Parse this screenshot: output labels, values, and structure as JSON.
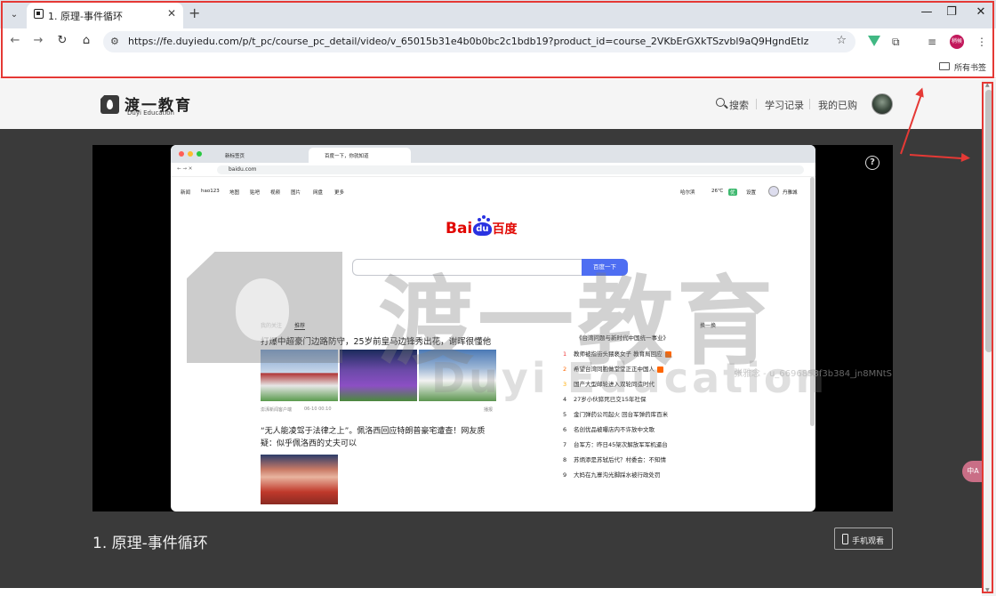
{
  "browser": {
    "tab_title": "1. 原理-事件循环",
    "url": "https://fe.duyiedu.com/p/t_pc/course_pc_detail/video/v_65015b31e4b0b0bc2c1bdb19?product_id=course_2VKbErGXkTSzvbl9aQ9HgndEtIz",
    "bookmarks_label": "所有书签",
    "profile_label": "稍候"
  },
  "site": {
    "logo_cn": "渡一教育",
    "logo_en": "Duyi Education",
    "nav": {
      "search": "搜索",
      "history": "学习记录",
      "purchased": "我的已购"
    }
  },
  "video": {
    "title": "1. 原理-事件循环",
    "mobile_watch": "手机观看",
    "help": "?",
    "watermark_id": "张雅念 - u_6696853f3b384_jn8MNtS",
    "watermark_cn": "渡一教育",
    "watermark_en": "Duyi Education",
    "float_badge": "中A"
  },
  "inner_browser": {
    "tabs": [
      "新标签页",
      "百度一下，你就知道"
    ],
    "url": "baidu.com",
    "nav_links": [
      "新闻",
      "hao123",
      "地图",
      "贴吧",
      "视频",
      "图片",
      "网盘",
      "更多"
    ],
    "city": "哈尔滨",
    "temperature": "26℃",
    "aqi": "优",
    "settings": "设置",
    "username": "丹雅城",
    "logo": {
      "bai": "Bai",
      "du": "du",
      "cn": "百度"
    },
    "search_button": "百度一下",
    "feed_tabs": [
      "我的关注",
      "推荐"
    ],
    "headline1": "打爆中超豪门边路防守，25岁前皇马边锋秀出花，谢晖很懂他",
    "source1": "澎湃新闻客户端",
    "time1": "06-10 00:10",
    "tag1": "播报",
    "headline2": "“无人能凌驾于法律之上”。佩洛西回应特朗普豪宅遭查！网友质疑：似乎佩洛西的丈夫可以",
    "hot_title": "《台湾问题与新时代中国统一事业》",
    "hot_switch": "换一换",
    "hot_list": [
      {
        "n": "1",
        "text": "教师被指街头猥亵女子 教育局回应",
        "badge": true
      },
      {
        "n": "2",
        "text": "希望台湾同胞做堂堂正正中国人",
        "badge": true
      },
      {
        "n": "3",
        "text": "国产大型邮轮进入双轮同造时代",
        "badge": false
      },
      {
        "n": "4",
        "text": "27岁小伙猝死已交15年社保",
        "badge": false
      },
      {
        "n": "5",
        "text": "金门弹药公司起火 回台军弹药库百米",
        "badge": false
      },
      {
        "n": "6",
        "text": "名创优品被曝店内不许放中文歌",
        "badge": false
      },
      {
        "n": "7",
        "text": "台军方：昨日45架次解放军军机逼台",
        "badge": false
      },
      {
        "n": "8",
        "text": "苏炳添是苏轼后代？村委会：不知情",
        "badge": false
      },
      {
        "n": "9",
        "text": "大妈在九寨沟光脚踩水被行政处罚",
        "badge": false
      }
    ]
  }
}
